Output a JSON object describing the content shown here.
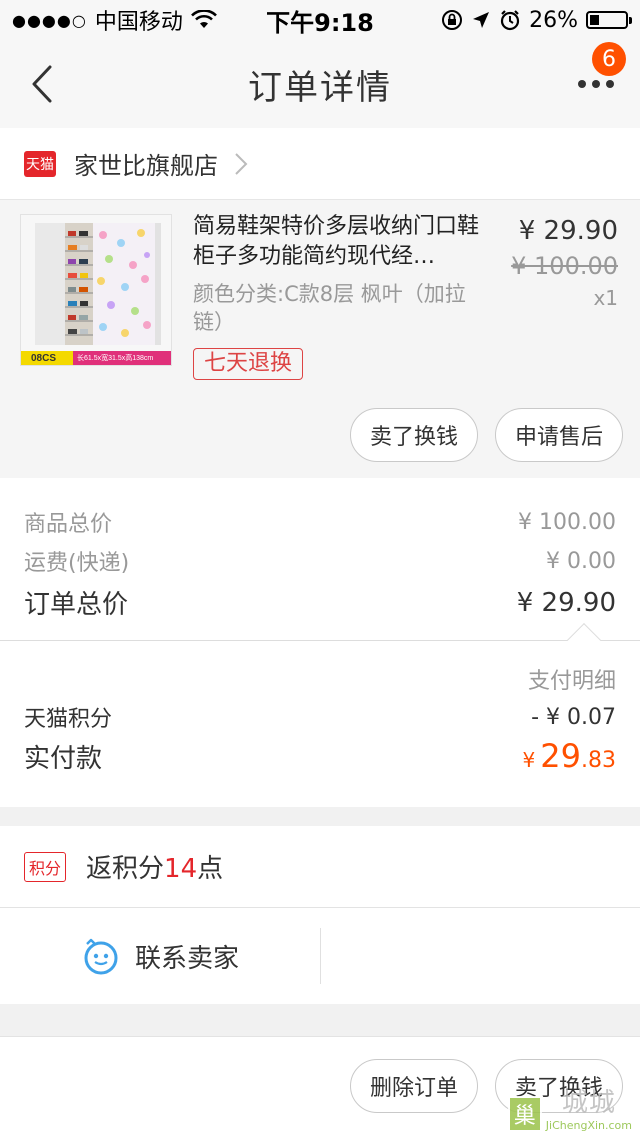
{
  "status_bar": {
    "carrier": "中国移动",
    "time": "下午9:18",
    "battery": "26%",
    "battery_level": 0.26
  },
  "nav": {
    "title": "订单详情",
    "badge": "6"
  },
  "shop": {
    "logo_text": "天猫",
    "name": "家世比旗舰店"
  },
  "item": {
    "title": "简易鞋架特价多层收纳门口鞋柜子多功能简约现代经…",
    "sku": "颜色分类:C款8层 枫叶（加拉链）",
    "tag": "七天退换",
    "price": "¥ 29.90",
    "original_price": "¥ 100.00",
    "quantity": "x1",
    "thumb_code": "08CS",
    "thumb_dims": "长61.5x宽31.5x高138cm",
    "buttons": {
      "sell": "卖了换钱",
      "after_sale": "申请售后"
    }
  },
  "summary": {
    "goods_total_label": "商品总价",
    "goods_total_value": "¥ 100.00",
    "shipping_label": "运费(快递)",
    "shipping_value": "¥ 0.00",
    "order_total_label": "订单总价",
    "order_total_value": "¥ 29.90"
  },
  "payment": {
    "detail_link": "支付明细",
    "points_label": "天猫积分",
    "points_value": "- ¥ 0.07",
    "actual_label": "实付款",
    "actual_yen": "¥",
    "actual_int": "29",
    "actual_dec": ".83"
  },
  "points_reward": {
    "tag": "积分",
    "prefix": "返积分",
    "number": "14",
    "suffix": "点"
  },
  "contact": {
    "label": "联系卖家"
  },
  "bottom": {
    "delete": "删除订单",
    "sell": "卖了换钱"
  },
  "watermark": {
    "box": "巢",
    "cn": "城城",
    "en": "JiChengXin.com"
  },
  "colors": {
    "accent_orange": "#ff5000",
    "tmall_red": "#e4262b",
    "contact_blue": "#3fa2e9"
  }
}
